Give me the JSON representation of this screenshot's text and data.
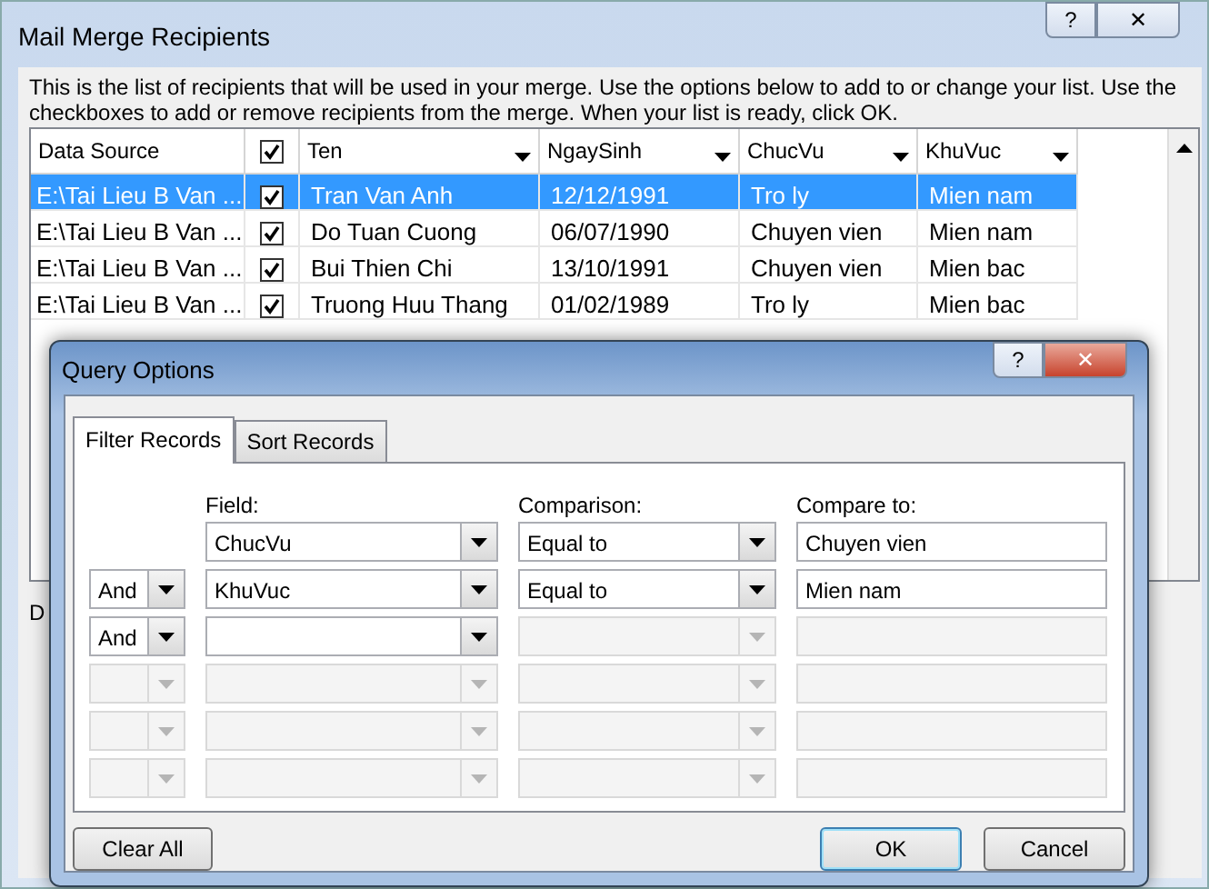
{
  "window": {
    "title": "Mail Merge Recipients",
    "help": "?",
    "close": "✕"
  },
  "intro": "This is the list of recipients that will be used in your merge.  Use the options below to add to or change your list.  Use the checkboxes to add or remove recipients from the merge.  When your list is ready, click OK.",
  "table": {
    "columns": [
      {
        "label": "Data Source",
        "kind": "text"
      },
      {
        "kind": "check",
        "checked": true
      },
      {
        "label": "Ten",
        "kind": "filter"
      },
      {
        "label": "NgaySinh",
        "kind": "filter"
      },
      {
        "label": "ChucVu",
        "kind": "filter"
      },
      {
        "label": "KhuVuc",
        "kind": "filter"
      }
    ],
    "rows": [
      {
        "selected": true,
        "checked": true,
        "cells": [
          "E:\\Tai Lieu B Van ...",
          null,
          "Tran Van Anh",
          "12/12/1991",
          "Tro ly",
          "Mien nam"
        ]
      },
      {
        "selected": false,
        "checked": true,
        "cells": [
          "E:\\Tai Lieu B Van ...",
          null,
          "Do Tuan Cuong",
          "06/07/1990",
          "Chuyen vien",
          "Mien nam"
        ]
      },
      {
        "selected": false,
        "checked": true,
        "cells": [
          "E:\\Tai Lieu B Van ...",
          null,
          "Bui Thien Chi",
          "13/10/1991",
          "Chuyen vien",
          "Mien bac"
        ]
      },
      {
        "selected": false,
        "checked": true,
        "cells": [
          "E:\\Tai Lieu B Van ...",
          null,
          "Truong Huu Thang",
          "01/02/1989",
          "Tro ly",
          "Mien bac"
        ]
      }
    ]
  },
  "below_label": "D",
  "dialog": {
    "title": "Query Options",
    "help": "?",
    "close": "✕",
    "tabs": [
      {
        "label": "Filter Records",
        "selected": true
      },
      {
        "label": "Sort Records",
        "selected": false
      }
    ],
    "headers": [
      "Field:",
      "Comparison:",
      "Compare to:"
    ],
    "rows": [
      {
        "conjunction": null,
        "field": {
          "value": "ChucVu",
          "disabled": false
        },
        "comparison": {
          "value": "Equal to",
          "disabled": false
        },
        "compare_to": {
          "value": "Chuyen vien",
          "disabled": false
        }
      },
      {
        "conjunction": {
          "value": "And",
          "disabled": false
        },
        "field": {
          "value": "KhuVuc",
          "disabled": false
        },
        "comparison": {
          "value": "Equal to",
          "disabled": false
        },
        "compare_to": {
          "value": "Mien nam",
          "disabled": false
        }
      },
      {
        "conjunction": {
          "value": "And",
          "disabled": false
        },
        "field": {
          "disabled": false
        },
        "comparison": {
          "disabled": true
        },
        "compare_to": {
          "disabled": true
        }
      },
      {
        "conjunction": {
          "disabled": true
        },
        "field": {
          "disabled": true
        },
        "comparison": {
          "disabled": true
        },
        "compare_to": {
          "disabled": true
        }
      },
      {
        "conjunction": {
          "disabled": true
        },
        "field": {
          "disabled": true
        },
        "comparison": {
          "disabled": true
        },
        "compare_to": {
          "disabled": true
        }
      },
      {
        "conjunction": {
          "disabled": true
        },
        "field": {
          "disabled": true
        },
        "comparison": {
          "disabled": true
        },
        "compare_to": {
          "disabled": true
        }
      }
    ],
    "buttons": [
      {
        "label": "Clear All",
        "default": false
      },
      {
        "label": "OK",
        "default": true
      },
      {
        "label": "Cancel",
        "default": false
      }
    ]
  }
}
